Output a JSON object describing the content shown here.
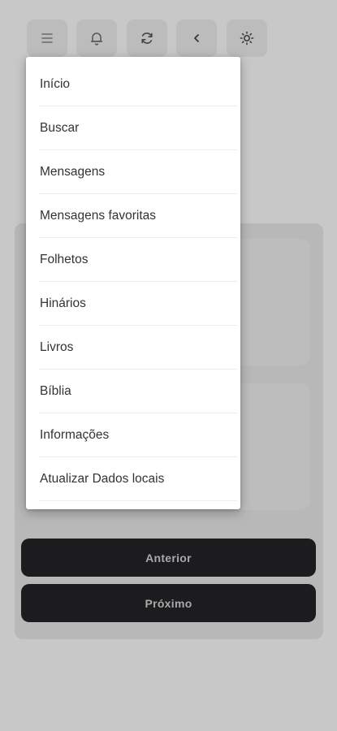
{
  "toolbar": {
    "buttons": [
      {
        "icon": "menu-icon"
      },
      {
        "icon": "bell-icon"
      },
      {
        "icon": "refresh-icon"
      },
      {
        "icon": "chevron-left-icon"
      },
      {
        "icon": "sun-icon"
      }
    ]
  },
  "menu": {
    "items": [
      {
        "label": "Início"
      },
      {
        "label": "Buscar"
      },
      {
        "label": "Mensagens"
      },
      {
        "label": "Mensagens favoritas"
      },
      {
        "label": "Folhetos"
      },
      {
        "label": "Hinários"
      },
      {
        "label": "Livros"
      },
      {
        "label": "Bíblia"
      },
      {
        "label": "Informações"
      },
      {
        "label": "Atualizar Dados locais"
      }
    ]
  },
  "navigation": {
    "previous_label": "Anterior",
    "next_label": "Próximo"
  },
  "colors": {
    "overlay_background": "#c8c8c8",
    "menu_background": "#ffffff",
    "button_background": "#1c1c1e",
    "button_text": "#a9a9a9"
  }
}
